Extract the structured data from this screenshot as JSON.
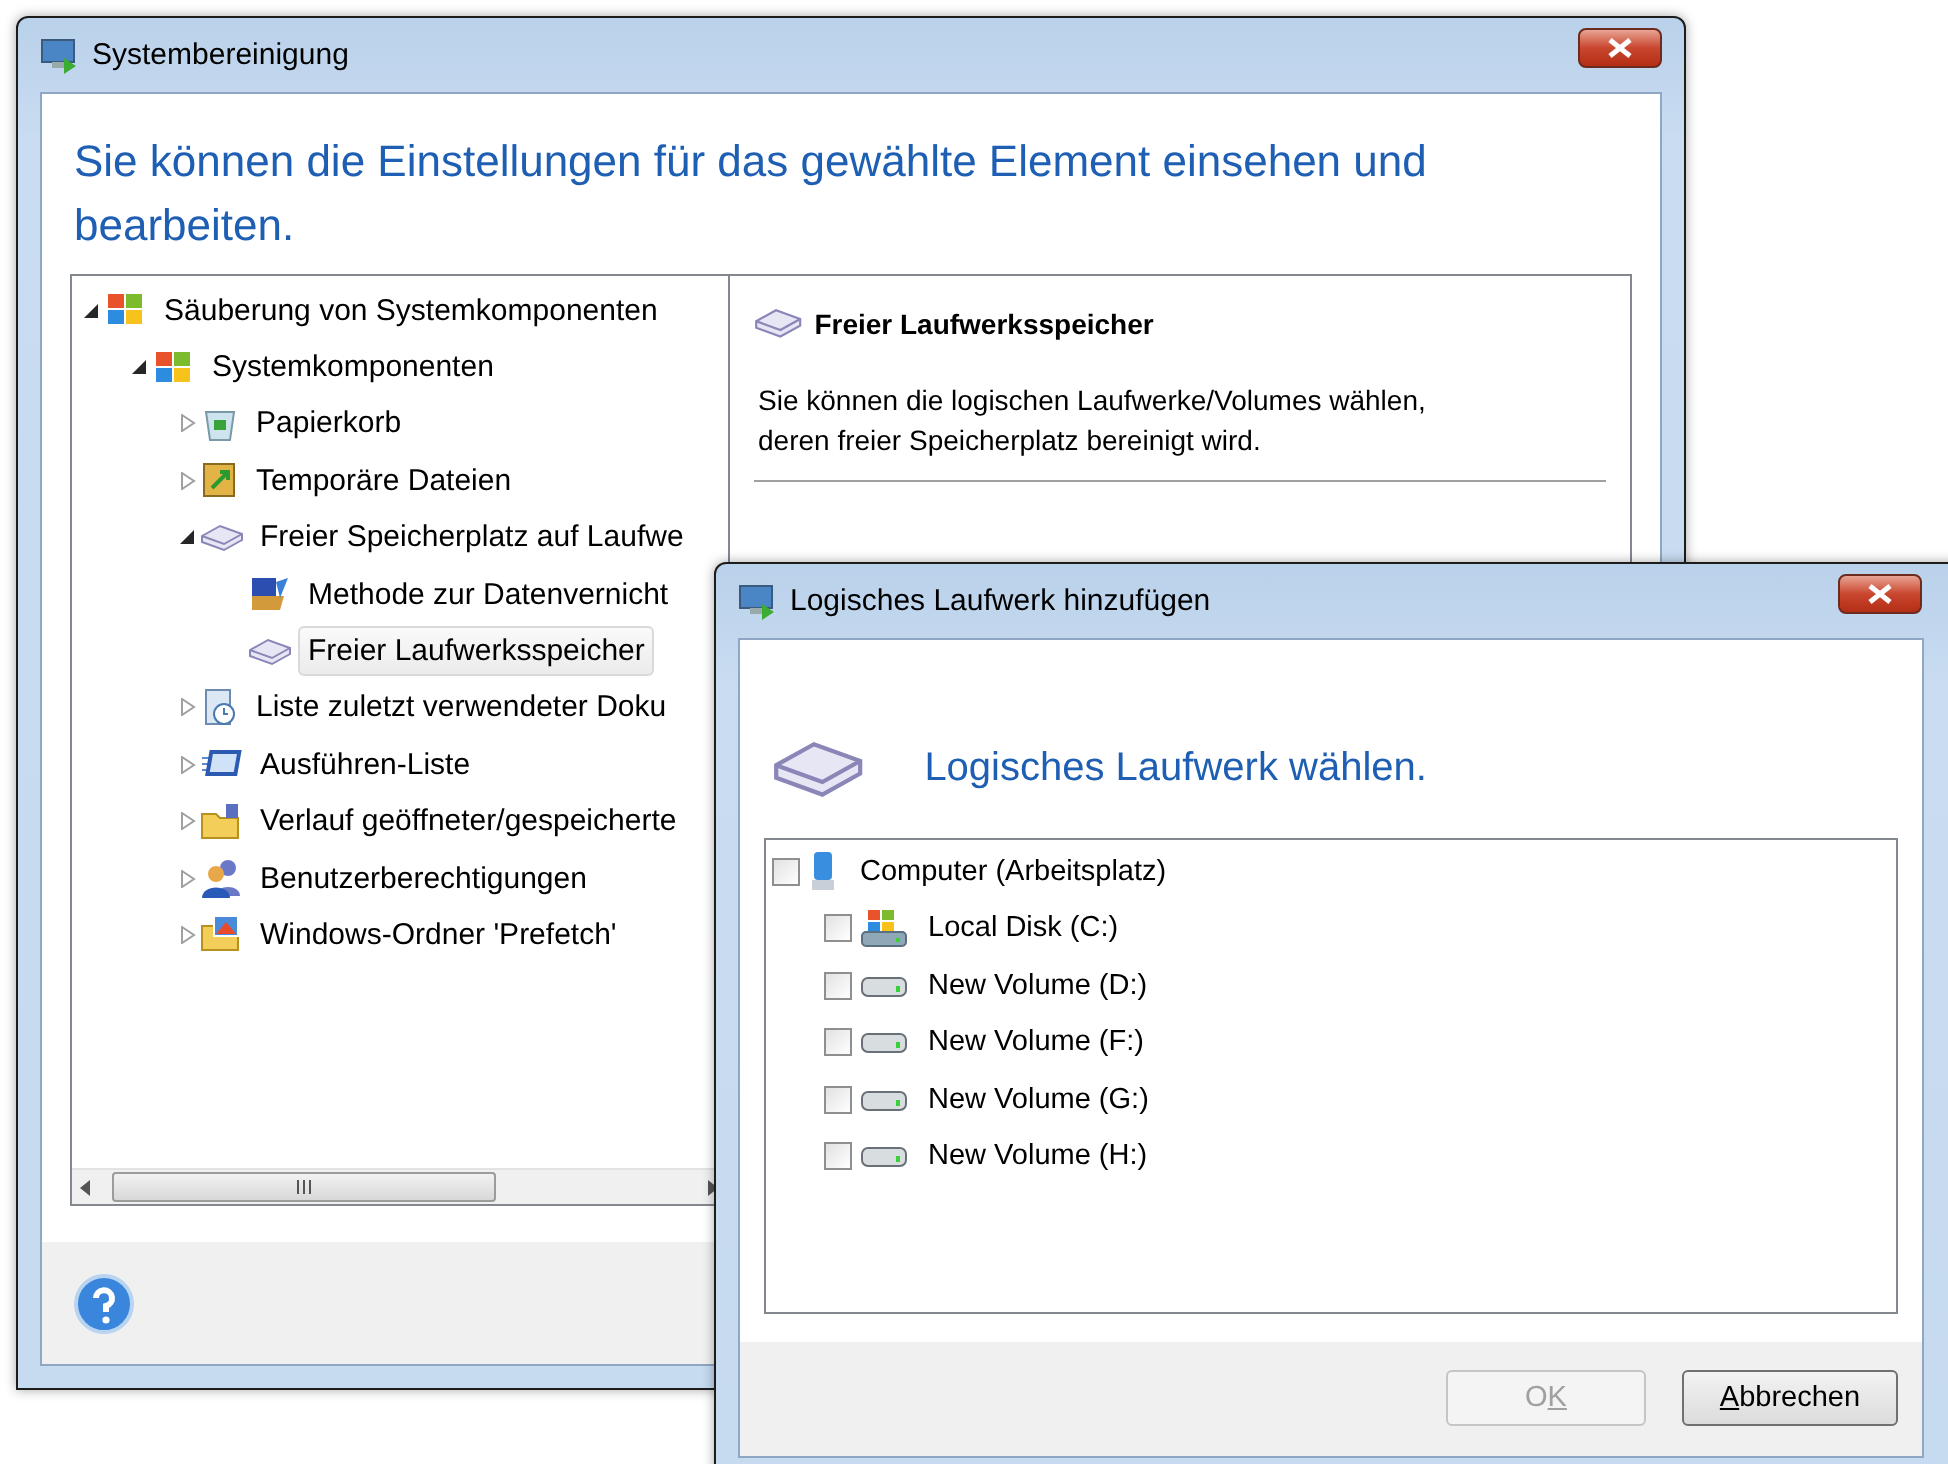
{
  "main_window": {
    "title": "Systembereinigung",
    "heading": "Sie können die Einstellungen für das gewählte Element einsehen und bearbeiten.",
    "tree": [
      {
        "label": "Säuberung von Systemkomponenten",
        "expanded": true,
        "selected": false,
        "children": [
          {
            "label": "Systemkomponenten",
            "expanded": true,
            "selected": false,
            "children": [
              {
                "label": "Papierkorb",
                "expanded": false,
                "selected": false
              },
              {
                "label": "Temporäre Dateien",
                "expanded": false,
                "selected": false
              },
              {
                "label": "Freier Speicherplatz auf Laufwe",
                "expanded": true,
                "selected": false,
                "children": [
                  {
                    "label": "Methode zur Datenvernicht",
                    "selected": false
                  },
                  {
                    "label": "Freier Laufwerksspeicher",
                    "selected": true
                  }
                ]
              },
              {
                "label": "Liste zuletzt verwendeter Doku",
                "expanded": false,
                "selected": false
              },
              {
                "label": "Ausführen-Liste",
                "expanded": false,
                "selected": false
              },
              {
                "label": "Verlauf geöffneter/gespeicherte",
                "expanded": false,
                "selected": false
              },
              {
                "label": "Benutzerberechtigungen",
                "expanded": false,
                "selected": false
              },
              {
                "label": "Windows-Ordner 'Prefetch'",
                "expanded": false,
                "selected": false
              }
            ]
          }
        ]
      }
    ],
    "detail": {
      "title": "Freier Laufwerksspeicher",
      "description": "Sie können die logischen Laufwerke/Volumes wählen, deren freier Speicherplatz bereinigt wird."
    }
  },
  "dialog": {
    "title": "Logisches Laufwerk hinzufügen",
    "heading": "Logisches Laufwerk wählen.",
    "drives": [
      {
        "label": "Computer (Arbeitsplatz)",
        "checked": false,
        "children": [
          {
            "label": "Local Disk (C:)",
            "checked": false
          },
          {
            "label": "New Volume (D:)",
            "checked": false
          },
          {
            "label": "New Volume (F:)",
            "checked": false
          },
          {
            "label": "New Volume (G:)",
            "checked": false
          },
          {
            "label": "New Volume (H:)",
            "checked": false
          }
        ]
      }
    ],
    "buttons": [
      {
        "label": [
          {
            "text": "O",
            "underlined": false
          },
          {
            "text": "K",
            "underlined": true
          }
        ],
        "disabled": true
      },
      {
        "label": [
          {
            "text": "A",
            "underlined": true
          },
          {
            "text": "bbrechen",
            "underlined": false
          }
        ],
        "disabled": false
      }
    ]
  }
}
